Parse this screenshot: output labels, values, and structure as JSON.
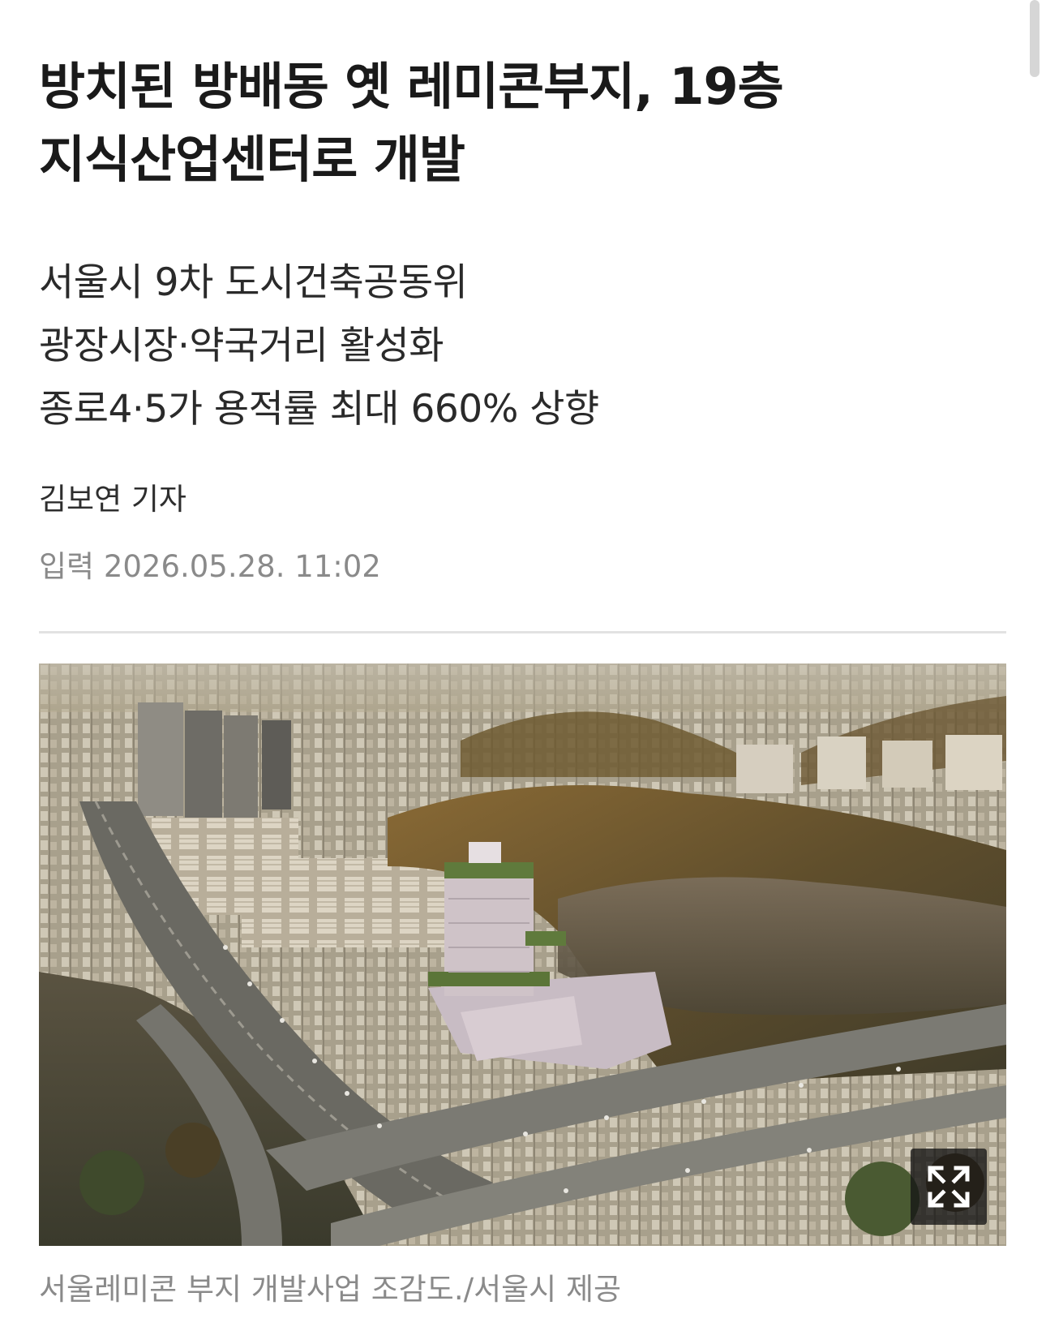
{
  "article": {
    "headline_lines": [
      "방치된 방배동 옛 레미콘부지, 19층",
      "지식산업센터로 개발"
    ],
    "subheads": [
      "서울시 9차 도시건축공동위",
      "광장시장·약국거리 활성화",
      "종로4·5가 용적률 최대 660% 상향"
    ],
    "byline": "김보연 기자",
    "dateline": "입력 2026.05.28. 11:02",
    "figure": {
      "caption": "서울레미콘 부지 개발사업 조감도./서울시 제공",
      "expand_icon": "expand-arrows-icon"
    }
  },
  "colors": {
    "headline": "#1a1a1a",
    "meta_gray": "#8a8a8a",
    "divider": "#e2e2e2"
  }
}
